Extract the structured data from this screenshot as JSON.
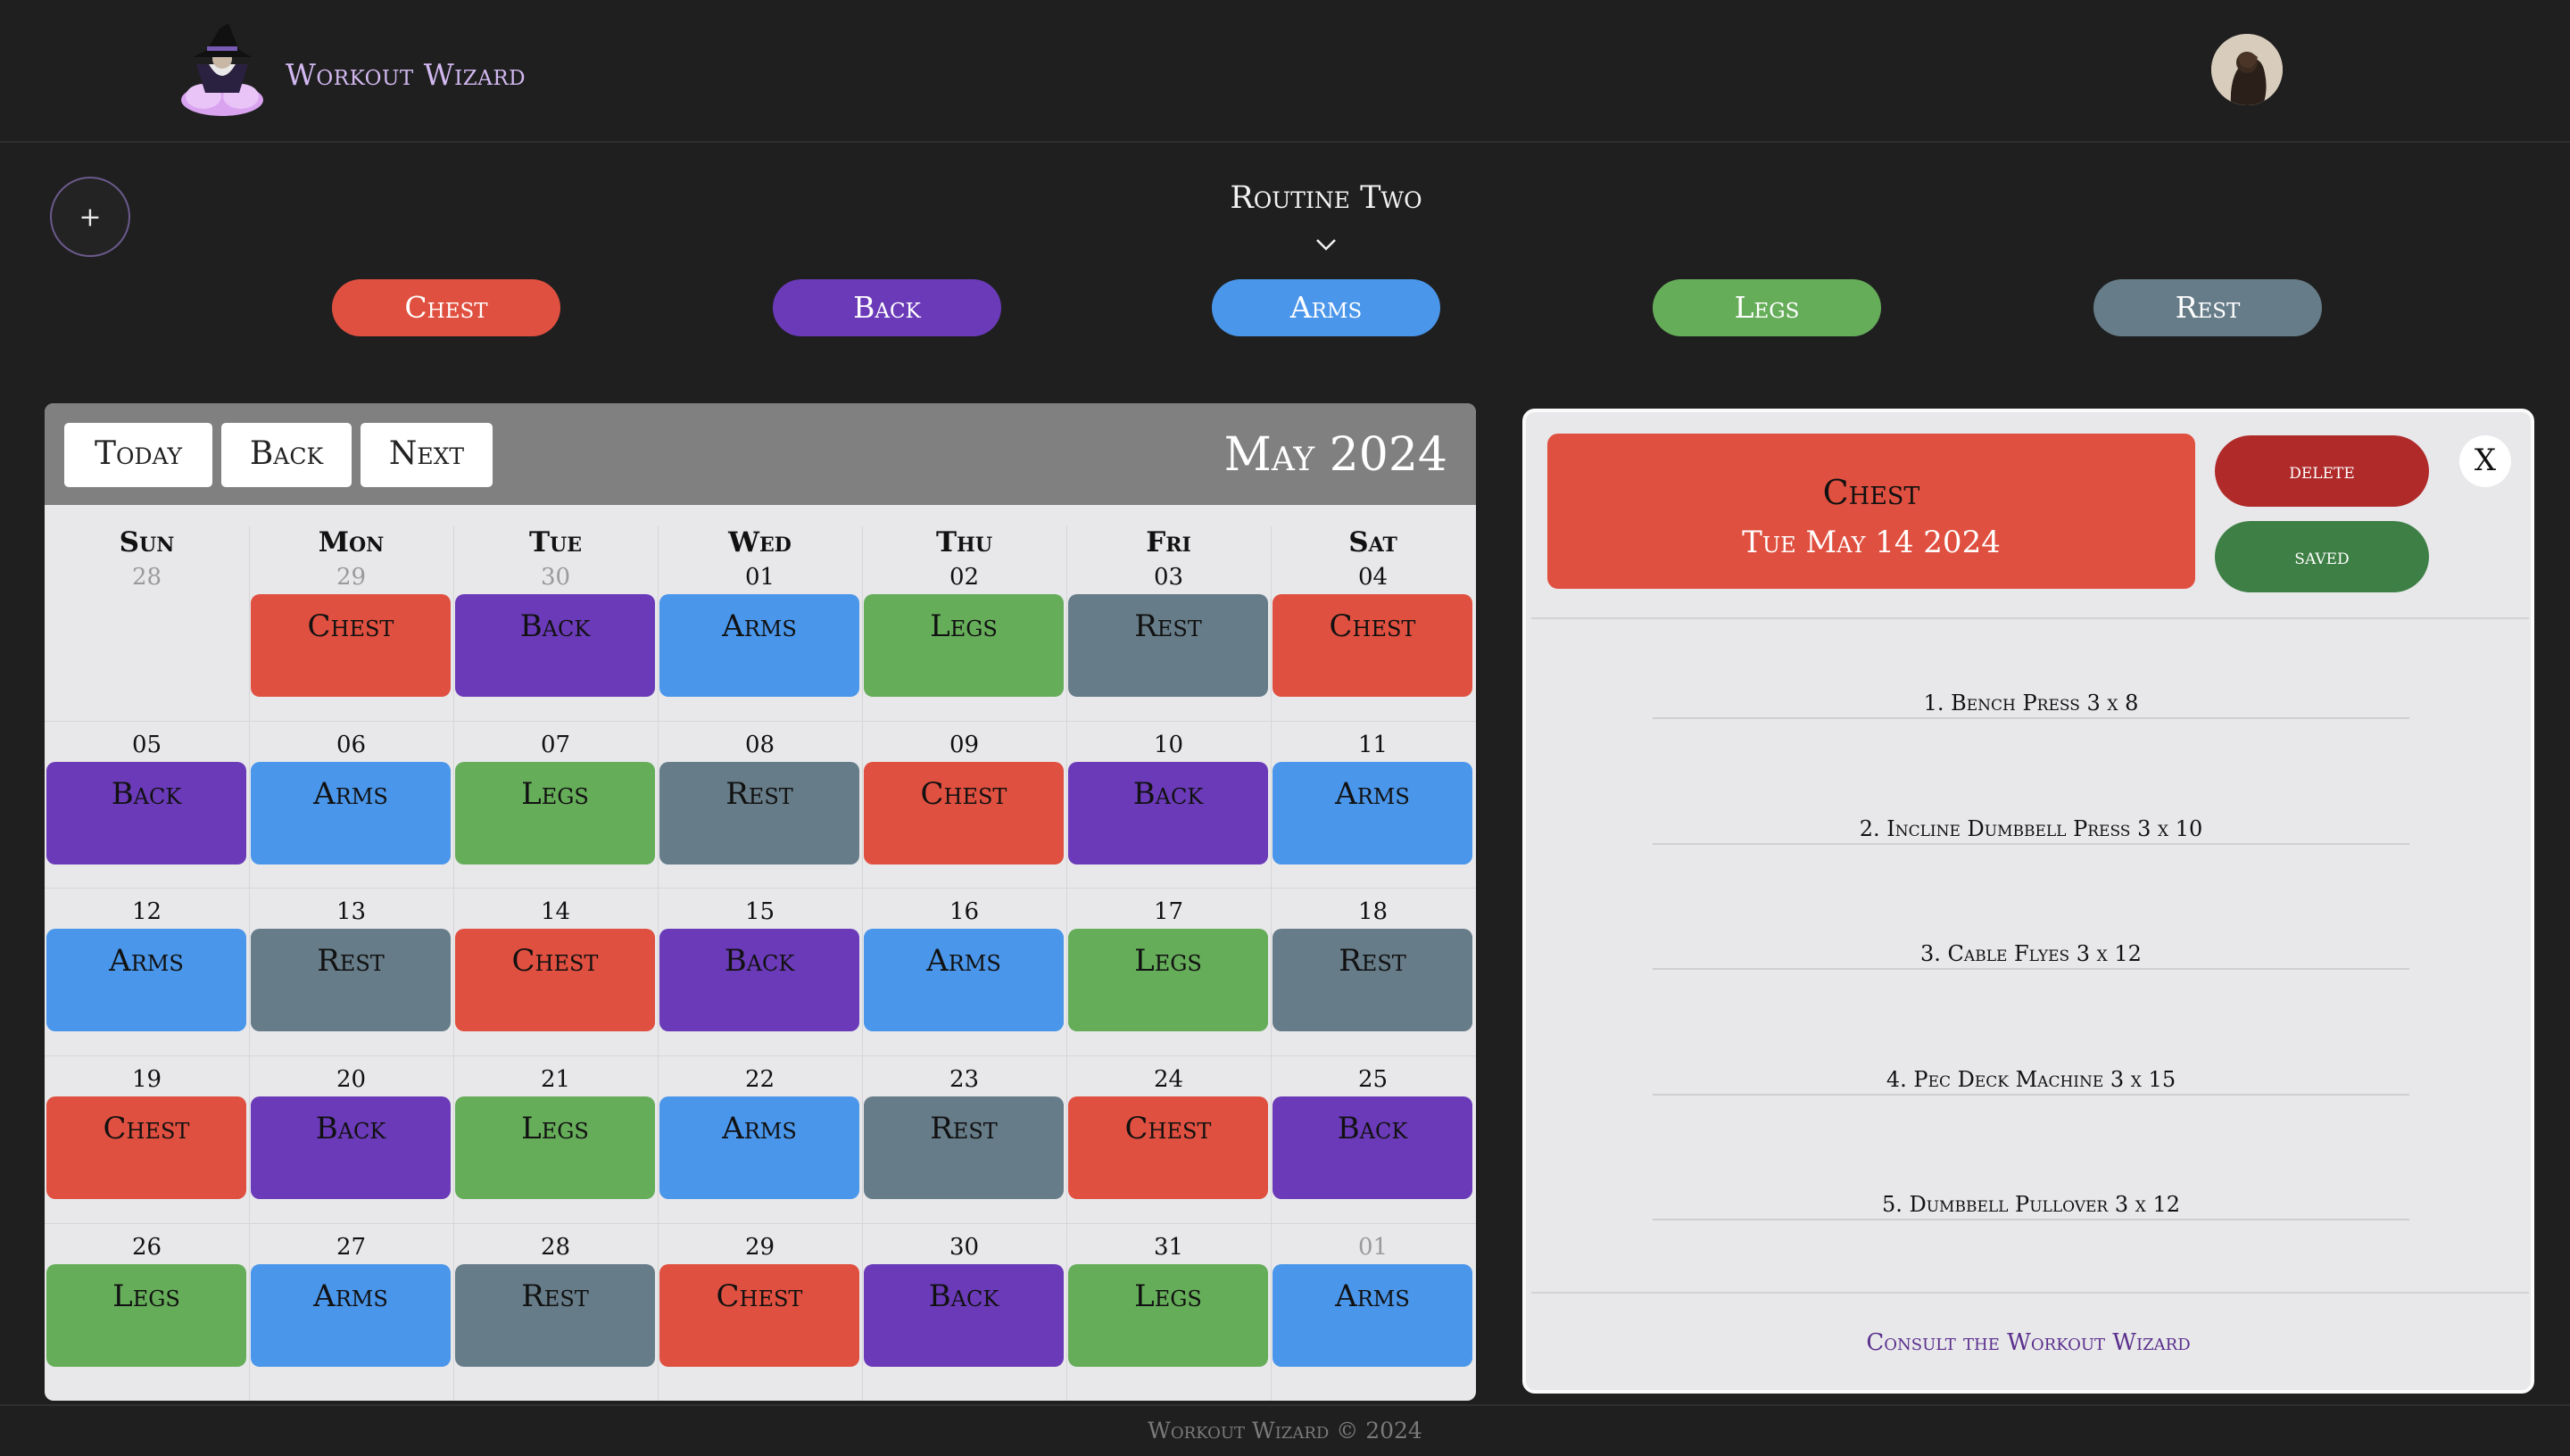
{
  "app": {
    "brand": "Workout Wizard",
    "footer": "Workout Wizard © 2024"
  },
  "routine": {
    "title": "Routine Two",
    "add_label": "+"
  },
  "legend": [
    {
      "label": "Chest",
      "color": "#e05040"
    },
    {
      "label": "Back",
      "color": "#6a3ab8"
    },
    {
      "label": "Arms",
      "color": "#4a96ea"
    },
    {
      "label": "Legs",
      "color": "#66ad5a"
    },
    {
      "label": "Rest",
      "color": "#667c88"
    }
  ],
  "calendar": {
    "toolbar": {
      "today": "Today",
      "back": "Back",
      "next": "Next"
    },
    "month": "May 2024",
    "weekdays": [
      "Sun",
      "Mon",
      "Tue",
      "Wed",
      "Thu",
      "Fri",
      "Sat"
    ],
    "weeks": [
      [
        {
          "day": "28",
          "muted": true,
          "workout": ""
        },
        {
          "day": "29",
          "muted": true,
          "workout": "Chest"
        },
        {
          "day": "30",
          "muted": true,
          "workout": "Back"
        },
        {
          "day": "01",
          "muted": false,
          "workout": "Arms"
        },
        {
          "day": "02",
          "muted": false,
          "workout": "Legs"
        },
        {
          "day": "03",
          "muted": false,
          "workout": "Rest"
        },
        {
          "day": "04",
          "muted": false,
          "workout": "Chest"
        }
      ],
      [
        {
          "day": "05",
          "muted": false,
          "workout": "Back"
        },
        {
          "day": "06",
          "muted": false,
          "workout": "Arms"
        },
        {
          "day": "07",
          "muted": false,
          "workout": "Legs"
        },
        {
          "day": "08",
          "muted": false,
          "workout": "Rest"
        },
        {
          "day": "09",
          "muted": false,
          "workout": "Chest"
        },
        {
          "day": "10",
          "muted": false,
          "workout": "Back"
        },
        {
          "day": "11",
          "muted": false,
          "workout": "Arms"
        }
      ],
      [
        {
          "day": "12",
          "muted": false,
          "workout": "Arms"
        },
        {
          "day": "13",
          "muted": false,
          "workout": "Rest"
        },
        {
          "day": "14",
          "muted": false,
          "workout": "Chest"
        },
        {
          "day": "15",
          "muted": false,
          "workout": "Back"
        },
        {
          "day": "16",
          "muted": false,
          "workout": "Arms"
        },
        {
          "day": "17",
          "muted": false,
          "workout": "Legs"
        },
        {
          "day": "18",
          "muted": false,
          "workout": "Rest"
        }
      ],
      [
        {
          "day": "19",
          "muted": false,
          "workout": "Chest"
        },
        {
          "day": "20",
          "muted": false,
          "workout": "Back"
        },
        {
          "day": "21",
          "muted": false,
          "workout": "Legs"
        },
        {
          "day": "22",
          "muted": false,
          "workout": "Arms"
        },
        {
          "day": "23",
          "muted": false,
          "workout": "Rest"
        },
        {
          "day": "24",
          "muted": false,
          "workout": "Chest"
        },
        {
          "day": "25",
          "muted": false,
          "workout": "Back"
        }
      ],
      [
        {
          "day": "26",
          "muted": false,
          "workout": "Legs"
        },
        {
          "day": "27",
          "muted": false,
          "workout": "Arms"
        },
        {
          "day": "28",
          "muted": false,
          "workout": "Rest"
        },
        {
          "day": "29",
          "muted": false,
          "workout": "Chest"
        },
        {
          "day": "30",
          "muted": false,
          "workout": "Back"
        },
        {
          "day": "31",
          "muted": false,
          "workout": "Legs"
        },
        {
          "day": "01",
          "muted": true,
          "workout": "Arms"
        }
      ]
    ]
  },
  "detail": {
    "workout": "Chest",
    "date": "Tue May 14 2024",
    "delete_label": "delete",
    "saved_label": "saved",
    "close_label": "X",
    "exercises": [
      "1. Bench Press 3 x 8",
      "2. Incline Dumbbell Press 3 x 10",
      "3. Cable Flyes 3 x 12",
      "4. Pec Deck Machine 3 x 15",
      "5. Dumbbell Pullover 3 x 12"
    ],
    "consult_label": "Consult the Workout Wizard"
  },
  "icons": {
    "logo": "wizard-logo-icon",
    "avatar": "user-avatar",
    "chevron": "chevron-down-icon"
  }
}
